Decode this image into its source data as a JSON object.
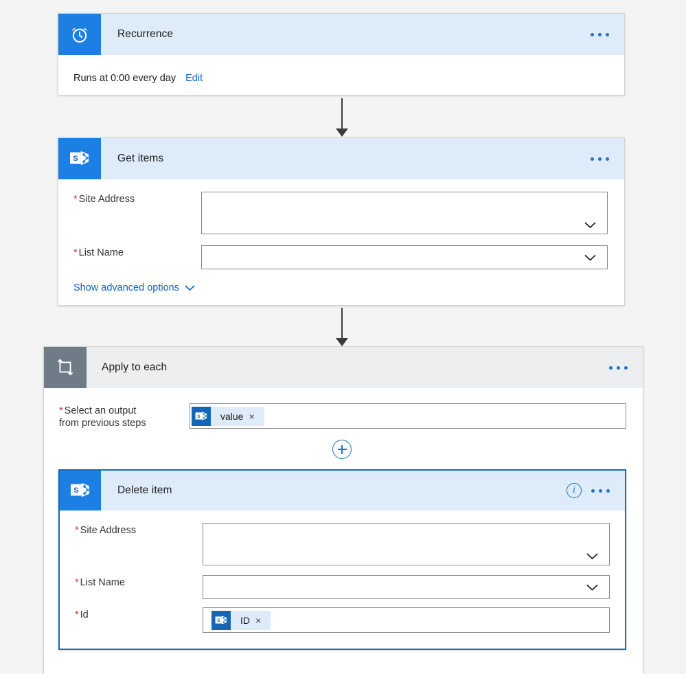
{
  "flow": {
    "nodes": [
      {
        "id": "recurrence",
        "title": "Recurrence",
        "icon": "alarm-clock-icon",
        "summary": "Runs at 0:00 every day",
        "edit_label": "Edit",
        "overflow_label": "More commands",
        "header_color": "#deecf9",
        "icon_color": "#1b7fe3"
      },
      {
        "id": "get-items",
        "title": "Get items",
        "icon": "sharepoint-icon",
        "header_color": "#deecf9",
        "icon_color": "#1b7fe3",
        "fields": [
          {
            "label": "Site Address",
            "required": true,
            "value": "",
            "control": "dropdown"
          },
          {
            "label": "List Name",
            "required": true,
            "value": "",
            "control": "dropdown"
          }
        ],
        "advanced_label": "Show advanced options"
      },
      {
        "id": "apply-to-each",
        "title": "Apply to each",
        "icon": "loop-icon",
        "header_color": "#eceef0",
        "icon_color": "#6f7c87",
        "fields": [
          {
            "label": "Select an output\nfrom previous steps",
            "label_line1": "Select an output",
            "label_line2": "from previous steps",
            "required": true,
            "token": {
              "text": "value",
              "icon": "sharepoint-icon",
              "remove_label": "×"
            }
          }
        ],
        "add_action_label": "+"
      },
      {
        "id": "delete-item",
        "title": "Delete item",
        "icon": "sharepoint-icon",
        "header_color": "#deecf9",
        "icon_color": "#1b7fe3",
        "selected": true,
        "border_color": "#0f6cbd",
        "info_label": "i",
        "fields": [
          {
            "label": "Site Address",
            "required": true,
            "value": "",
            "control": "dropdown"
          },
          {
            "label": "List Name",
            "required": true,
            "value": "",
            "control": "dropdown"
          },
          {
            "label": "Id",
            "required": true,
            "token": {
              "text": "ID",
              "icon": "sharepoint-icon",
              "remove_label": "×"
            }
          }
        ]
      }
    ],
    "colors": {
      "canvas": "#f4f4f4",
      "header_blue": "#deecf9",
      "header_gray": "#eceef0",
      "accent": "#1e72c8",
      "link": "#0b63ce",
      "required": "#d13438",
      "connector": "#3b3b3b",
      "selected_border": "#0f6cbd"
    }
  }
}
